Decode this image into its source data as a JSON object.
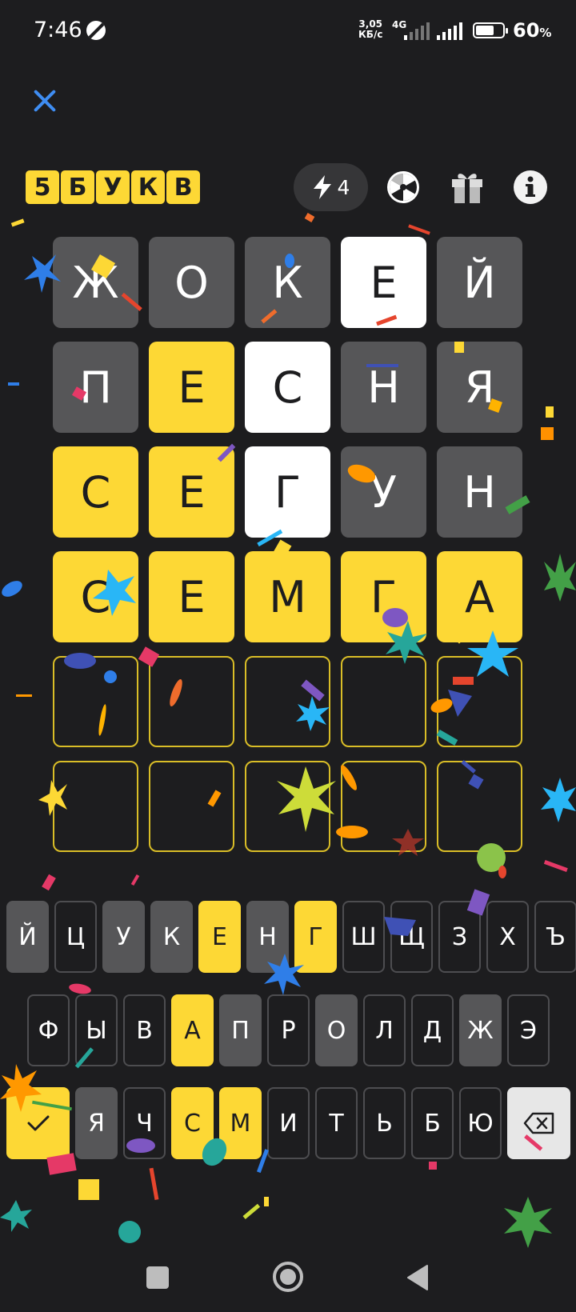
{
  "status_bar": {
    "time": "7:46",
    "net_speed_value": "3,05",
    "net_speed_unit": "КБ/с",
    "network_type": "4G",
    "battery_percent": "60",
    "battery_sign": "%"
  },
  "header": {
    "logo_letters": [
      "5",
      "Б",
      "У",
      "К",
      "В"
    ],
    "energy_count": "4"
  },
  "board": {
    "rows": [
      [
        {
          "letter": "Ж",
          "state": "absent"
        },
        {
          "letter": "О",
          "state": "absent"
        },
        {
          "letter": "К",
          "state": "absent"
        },
        {
          "letter": "Е",
          "state": "present"
        },
        {
          "letter": "Й",
          "state": "absent"
        }
      ],
      [
        {
          "letter": "П",
          "state": "absent"
        },
        {
          "letter": "Е",
          "state": "correct"
        },
        {
          "letter": "С",
          "state": "present"
        },
        {
          "letter": "Н",
          "state": "absent"
        },
        {
          "letter": "Я",
          "state": "absent"
        }
      ],
      [
        {
          "letter": "С",
          "state": "correct"
        },
        {
          "letter": "Е",
          "state": "correct"
        },
        {
          "letter": "Г",
          "state": "present"
        },
        {
          "letter": "У",
          "state": "absent"
        },
        {
          "letter": "Н",
          "state": "absent"
        }
      ],
      [
        {
          "letter": "С",
          "state": "correct"
        },
        {
          "letter": "Е",
          "state": "correct"
        },
        {
          "letter": "М",
          "state": "correct"
        },
        {
          "letter": "Г",
          "state": "correct"
        },
        {
          "letter": "А",
          "state": "correct"
        }
      ],
      [
        {
          "letter": "",
          "state": "empty"
        },
        {
          "letter": "",
          "state": "empty"
        },
        {
          "letter": "",
          "state": "empty"
        },
        {
          "letter": "",
          "state": "empty"
        },
        {
          "letter": "",
          "state": "empty"
        }
      ],
      [
        {
          "letter": "",
          "state": "empty"
        },
        {
          "letter": "",
          "state": "empty"
        },
        {
          "letter": "",
          "state": "empty"
        },
        {
          "letter": "",
          "state": "empty"
        },
        {
          "letter": "",
          "state": "empty"
        }
      ]
    ]
  },
  "keyboard": {
    "row1": [
      {
        "key": "Й",
        "state": "absent"
      },
      {
        "key": "Ц",
        "state": "unused"
      },
      {
        "key": "У",
        "state": "absent"
      },
      {
        "key": "К",
        "state": "absent"
      },
      {
        "key": "Е",
        "state": "correct"
      },
      {
        "key": "Н",
        "state": "absent"
      },
      {
        "key": "Г",
        "state": "correct"
      },
      {
        "key": "Ш",
        "state": "unused"
      },
      {
        "key": "Щ",
        "state": "unused"
      },
      {
        "key": "З",
        "state": "unused"
      },
      {
        "key": "Х",
        "state": "unused"
      },
      {
        "key": "Ъ",
        "state": "unused"
      }
    ],
    "row2": [
      {
        "key": "Ф",
        "state": "unused"
      },
      {
        "key": "Ы",
        "state": "unused"
      },
      {
        "key": "В",
        "state": "unused"
      },
      {
        "key": "А",
        "state": "correct"
      },
      {
        "key": "П",
        "state": "absent"
      },
      {
        "key": "Р",
        "state": "unused"
      },
      {
        "key": "О",
        "state": "absent"
      },
      {
        "key": "Л",
        "state": "unused"
      },
      {
        "key": "Д",
        "state": "unused"
      },
      {
        "key": "Ж",
        "state": "absent"
      },
      {
        "key": "Э",
        "state": "unused"
      }
    ],
    "row3": [
      {
        "key": "Я",
        "state": "absent"
      },
      {
        "key": "Ч",
        "state": "unused"
      },
      {
        "key": "С",
        "state": "correct"
      },
      {
        "key": "М",
        "state": "correct"
      },
      {
        "key": "И",
        "state": "unused"
      },
      {
        "key": "Т",
        "state": "unused"
      },
      {
        "key": "Ь",
        "state": "unused"
      },
      {
        "key": "Б",
        "state": "unused"
      },
      {
        "key": "Ю",
        "state": "unused"
      }
    ]
  },
  "colors": {
    "background": "#1d1d1f",
    "correct": "#fdd835",
    "absent": "#565658",
    "present": "#ffffff",
    "empty_border": "#d9bd27",
    "close_icon": "#3f8df2"
  },
  "icons": {
    "close": "close-icon",
    "energy": "lightning-icon",
    "wheel": "fortune-wheel-icon",
    "gift": "gift-icon",
    "info": "info-icon",
    "enter": "checkmark-icon",
    "backspace": "backspace-icon",
    "nav_recents": "square-icon",
    "nav_home": "circle-icon",
    "nav_back": "triangle-back-icon"
  }
}
